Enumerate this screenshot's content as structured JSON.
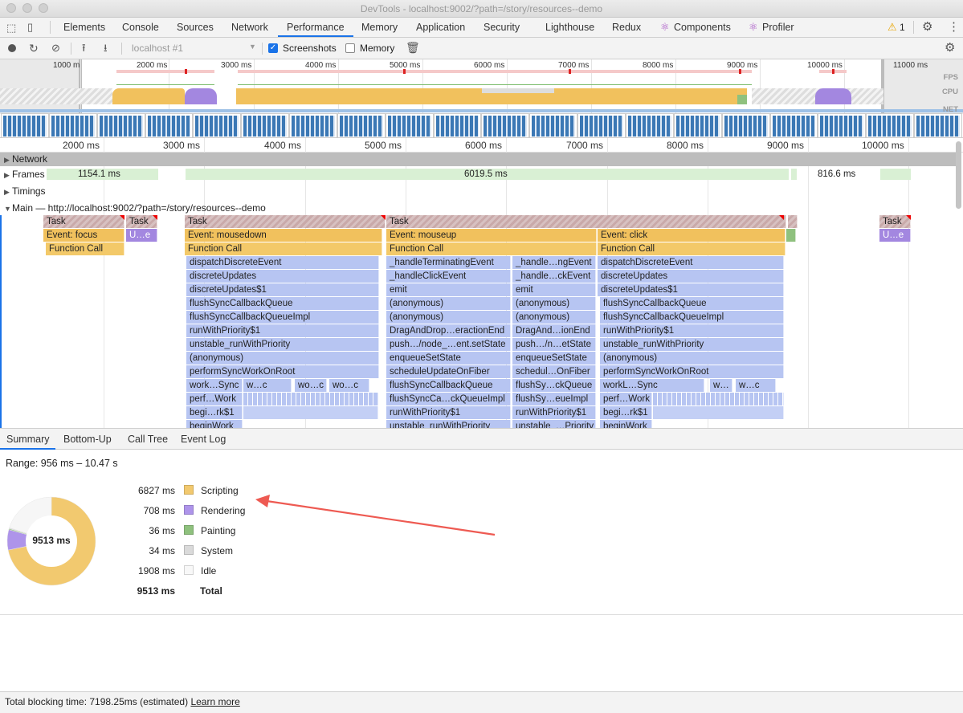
{
  "window": {
    "title": "DevTools - localhost:9002/?path=/story/resources--demo"
  },
  "tabs": [
    {
      "label": "Elements"
    },
    {
      "label": "Console"
    },
    {
      "label": "Sources"
    },
    {
      "label": "Network"
    },
    {
      "label": "Performance"
    },
    {
      "label": "Memory"
    },
    {
      "label": "Application"
    },
    {
      "label": "Security"
    },
    {
      "label": "Lighthouse"
    },
    {
      "label": "Redux"
    },
    {
      "label": "Components"
    },
    {
      "label": "Profiler"
    }
  ],
  "active_tab": "Performance",
  "warnings": {
    "count": "1"
  },
  "toolbar": {
    "target": "localhost #1",
    "screenshots_label": "Screenshots",
    "screenshots_checked": true,
    "memory_label": "Memory",
    "memory_checked": false
  },
  "overview": {
    "ticks": [
      "1000 m",
      "2000 ms",
      "3000 ms",
      "4000 ms",
      "5000 ms",
      "6000 ms",
      "7000 ms",
      "8000 ms",
      "9000 ms",
      "10000 ms",
      "11000 ms"
    ],
    "lanes": {
      "fps": "FPS",
      "cpu": "CPU",
      "net": "NET"
    }
  },
  "ruler": {
    "ticks": [
      "2000 ms",
      "3000 ms",
      "4000 ms",
      "5000 ms",
      "6000 ms",
      "7000 ms",
      "8000 ms",
      "9000 ms",
      "10000 ms"
    ]
  },
  "tracks": {
    "network": "Network",
    "frames": "Frames",
    "frames_values": [
      "1154.1 ms",
      "6019.5 ms",
      "816.6 ms"
    ],
    "timings": "Timings",
    "main": "Main — http://localhost:9002/?path=/story/resources--demo"
  },
  "flame": {
    "tasks": [
      "Task",
      "Task",
      "Task",
      "Task",
      "Task"
    ],
    "events": [
      "Event: focus",
      "U…e",
      "Event: mousedown",
      "Event: mouseup",
      "Event: click",
      "U…e"
    ],
    "calls": [
      "Function Call",
      "Function Call",
      "Function Call",
      "Function Call"
    ],
    "col_mousedown": [
      "dispatchDiscreteEvent",
      "discreteUpdates",
      "discreteUpdates$1",
      "flushSyncCallbackQueue",
      "flushSyncCallbackQueueImpl",
      "runWithPriority$1",
      "unstable_runWithPriority",
      "(anonymous)",
      "performSyncWorkOnRoot",
      "work…Sync",
      "perf…Work",
      "begi…rk$1",
      "beginWork"
    ],
    "col_mousedown_extra": [
      "w…c",
      "wo…c",
      "wo…c"
    ],
    "col_mouseup_a": [
      "_handleTerminatingEvent",
      "_handleClickEvent",
      "emit",
      "(anonymous)",
      "(anonymous)",
      "DragAndDrop…eractionEnd",
      "push…/node_…ent.setState",
      "enqueueSetState",
      "scheduleUpdateOnFiber",
      "flushSyncCallbackQueue",
      "flushSyncCa…ckQueueImpl",
      "runWithPriority$1",
      "unstable_runWithPriority"
    ],
    "col_mouseup_b": [
      "_handle…ngEvent",
      "_handle…ckEvent",
      "emit",
      "(anonymous)",
      "(anonymous)",
      "DragAnd…ionEnd",
      "push…/n…etState",
      "enqueueSetState",
      "schedul…OnFiber",
      "flushSy…ckQueue",
      "flushSy…eueImpl",
      "runWithPriority$1",
      "unstable_…Priority"
    ],
    "col_click": [
      "dispatchDiscreteEvent",
      "discreteUpdates",
      "discreteUpdates$1",
      "flushSyncCallbackQueue",
      "flushSyncCallbackQueueImpl",
      "runWithPriority$1",
      "unstable_runWithPriority",
      "(anonymous)",
      "performSyncWorkOnRoot",
      "workL…Sync",
      "perf…Work",
      "begi…rk$1",
      "beginWork"
    ],
    "col_click_extra": [
      "w…",
      "w…c"
    ]
  },
  "bottom_tabs": [
    {
      "label": "Summary"
    },
    {
      "label": "Bottom-Up"
    },
    {
      "label": "Call Tree"
    },
    {
      "label": "Event Log"
    }
  ],
  "summary": {
    "range": "Range: 956 ms – 10.47 s",
    "total_center": "9513 ms",
    "rows": [
      {
        "value": "6827 ms",
        "label": "Scripting",
        "color": "#f2c96f",
        "ms": 6827
      },
      {
        "value": "708 ms",
        "label": "Rendering",
        "color": "#ae94ea",
        "ms": 708
      },
      {
        "value": "36 ms",
        "label": "Painting",
        "color": "#8fc17e",
        "ms": 36
      },
      {
        "value": "34 ms",
        "label": "System",
        "color": "#dadada",
        "ms": 34
      },
      {
        "value": "1908 ms",
        "label": "Idle",
        "color": "#f6f6f6",
        "ms": 1908
      }
    ],
    "total": {
      "value": "9513 ms",
      "label": "Total"
    }
  },
  "status": {
    "text": "Total blocking time: 7198.25ms (estimated)",
    "link": "Learn more"
  }
}
